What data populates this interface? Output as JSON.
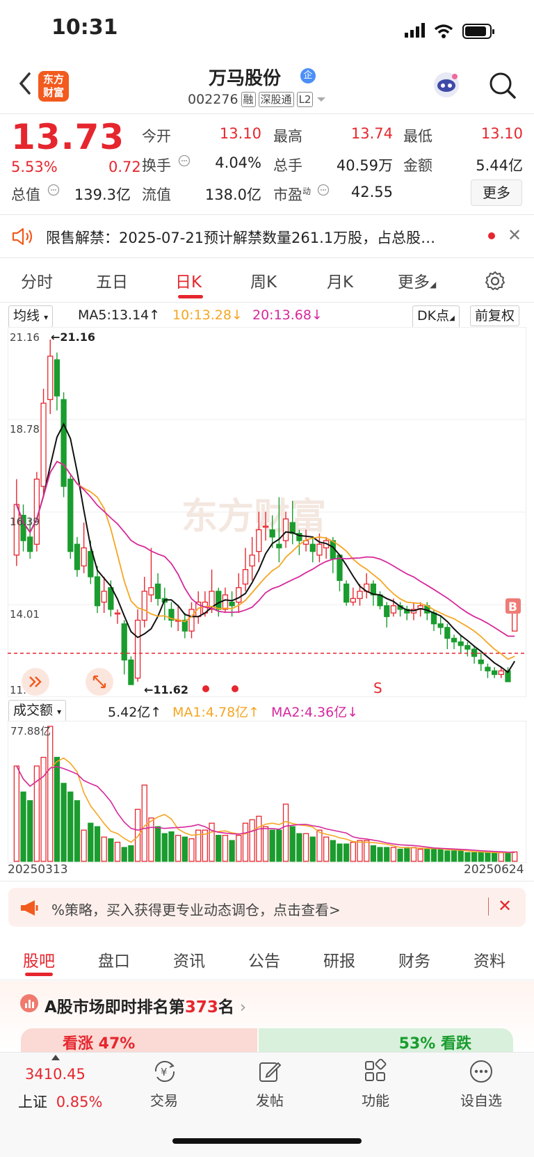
{
  "status_bar": {
    "time": "10:31"
  },
  "header": {
    "logo_text_line1": "东方",
    "logo_text_line2": "财富",
    "stock_name": "万马股份",
    "corp_badge": "企",
    "stock_code": "002276",
    "tags": [
      "融",
      "深股通",
      "L2"
    ]
  },
  "quote": {
    "price": "13.73",
    "change_pct": "5.53%",
    "change": "0.72",
    "open_label": "今开",
    "open": "13.10",
    "high_label": "最高",
    "high": "13.74",
    "low_label": "最低",
    "low": "13.10",
    "turnover_label": "换手",
    "turnover": "4.04%",
    "volume_label": "总手",
    "volume": "40.59万",
    "amount_label": "金额",
    "amount": "5.44亿",
    "mktcap_label": "总值",
    "mktcap": "139.3亿",
    "float_label": "流值",
    "float_cap": "138.0亿",
    "pe_label": "市盈",
    "pe_sup": "动",
    "pe": "42.55",
    "more_label": "更多"
  },
  "notice": {
    "text": "限售解禁：2025-07-21预计解禁数量261.1万股，占总股…"
  },
  "chart_tabs": [
    "分时",
    "五日",
    "日K",
    "周K",
    "月K",
    "更多"
  ],
  "ma_row": {
    "selector": "均线",
    "ma5": "MA5:13.14",
    "ma10": "10:13.28",
    "ma20": "20:13.68",
    "dk_label": "DK点",
    "adjust_label": "前复权"
  },
  "colors": {
    "up": "#e6262e",
    "down": "#1a9c2e",
    "ma5": "#111111",
    "ma10": "#f5a623",
    "ma20": "#d6289c"
  },
  "kline_axis": {
    "max": "21.16",
    "l2": "18.78",
    "l3": "16.39",
    "l4": "14.01",
    "min": "11.62",
    "max_mark": "21.16",
    "min_mark": "11.62"
  },
  "markers": {
    "b": "B",
    "s": "S"
  },
  "vol_row": {
    "selector": "成交额",
    "current": "5.42亿",
    "ma1": "MA1:4.78亿",
    "ma2": "MA2:4.36亿",
    "axis_max": "77.88亿"
  },
  "dates": {
    "start": "20250313",
    "end": "20250624"
  },
  "promo": {
    "text": "%策略，买入获得更专业动态调仓，点击查看>"
  },
  "bottom_tabs": [
    "股吧",
    "盘口",
    "资讯",
    "公告",
    "研报",
    "财务",
    "资料"
  ],
  "rank": {
    "prefix": "A股市场即时排名第",
    "number": "373",
    "suffix": "名"
  },
  "sentiment": {
    "left": "看涨 47%",
    "right": "53% 看跌"
  },
  "index": {
    "value": "3410.45",
    "name": "上证",
    "pct": "0.85%"
  },
  "bottom_nav": [
    "交易",
    "发帖",
    "功能",
    "设自选"
  ],
  "chart_data": {
    "type": "candlestick",
    "x_start": "20250313",
    "x_end": "20250624",
    "ylim": [
      11.62,
      21.16
    ],
    "candles": [
      [
        15.2,
        16.6,
        17.3,
        14.9
      ],
      [
        16.3,
        15.6,
        16.6,
        15.3
      ],
      [
        15.7,
        15.3,
        16.2,
        15.1
      ],
      [
        15.5,
        17.3,
        17.5,
        15.3
      ],
      [
        17.1,
        19.4,
        19.8,
        16.8
      ],
      [
        19.5,
        20.7,
        21.16,
        19.1
      ],
      [
        20.6,
        19.6,
        20.8,
        19.2
      ],
      [
        19.5,
        17.1,
        19.7,
        16.8
      ],
      [
        17.3,
        15.3,
        17.4,
        15.1
      ],
      [
        15.5,
        14.8,
        15.7,
        14.6
      ],
      [
        14.9,
        15.4,
        16.1,
        14.7
      ],
      [
        15.3,
        14.6,
        15.6,
        14.4
      ],
      [
        14.6,
        13.8,
        14.9,
        13.6
      ],
      [
        13.9,
        14.2,
        14.6,
        13.6
      ],
      [
        14.3,
        13.7,
        14.5,
        13.5
      ],
      [
        13.6,
        13.6,
        13.7,
        13.3
      ],
      [
        13.3,
        12.3,
        13.4,
        11.9
      ],
      [
        12.3,
        11.62,
        12.4,
        11.62
      ],
      [
        11.8,
        13.4,
        13.7,
        11.7
      ],
      [
        13.4,
        14.2,
        14.6,
        13.2
      ],
      [
        14.1,
        14.3,
        15.4,
        13.9
      ],
      [
        14.4,
        14.0,
        14.7,
        13.8
      ],
      [
        14.0,
        13.9,
        14.3,
        13.4
      ],
      [
        13.7,
        13.4,
        13.9,
        13.2
      ],
      [
        13.4,
        13.4,
        13.8,
        13.1
      ],
      [
        13.4,
        13.1,
        13.6,
        12.9
      ],
      [
        13.1,
        13.7,
        13.9,
        12.9
      ],
      [
        13.5,
        13.9,
        14.2,
        13.3
      ],
      [
        13.6,
        13.9,
        14.2,
        13.5
      ],
      [
        13.7,
        14.2,
        14.8,
        13.6
      ],
      [
        14.2,
        13.7,
        14.3,
        13.5
      ],
      [
        13.7,
        14.1,
        14.3,
        13.6
      ],
      [
        13.9,
        13.8,
        14.2,
        13.5
      ],
      [
        13.9,
        14.3,
        14.7,
        13.6
      ],
      [
        14.4,
        14.8,
        15.4,
        14.2
      ],
      [
        14.9,
        15.2,
        15.7,
        14.5
      ],
      [
        15.3,
        15.9,
        16.4,
        15.0
      ],
      [
        16.0,
        16.0,
        16.4,
        15.6
      ],
      [
        15.9,
        15.7,
        16.3,
        15.4
      ],
      [
        15.5,
        15.4,
        16.8,
        15.0
      ],
      [
        15.6,
        16.2,
        16.4,
        15.4
      ],
      [
        16.1,
        15.8,
        16.7,
        15.5
      ],
      [
        15.8,
        15.6,
        15.9,
        15.2
      ],
      [
        15.5,
        15.6,
        15.9,
        15.3
      ],
      [
        15.5,
        15.3,
        15.7,
        15.0
      ],
      [
        15.2,
        15.5,
        15.8,
        15.0
      ],
      [
        15.4,
        15.6,
        15.7,
        15.1
      ],
      [
        15.6,
        15.1,
        15.7,
        14.7
      ],
      [
        15.2,
        14.5,
        15.2,
        14.2
      ],
      [
        14.4,
        13.9,
        14.5,
        13.8
      ],
      [
        13.9,
        14.0,
        14.3,
        13.8
      ],
      [
        14.0,
        14.2,
        14.4,
        13.8
      ],
      [
        14.2,
        14.4,
        14.7,
        14.0
      ],
      [
        14.4,
        14.1,
        14.5,
        13.8
      ],
      [
        14.1,
        13.8,
        14.2,
        13.7
      ],
      [
        13.8,
        13.5,
        13.9,
        13.2
      ],
      [
        13.6,
        13.8,
        14.0,
        13.5
      ],
      [
        13.8,
        13.7,
        13.9,
        13.5
      ],
      [
        13.7,
        13.6,
        13.8,
        13.4
      ],
      [
        13.6,
        13.7,
        13.9,
        13.4
      ],
      [
        13.7,
        13.8,
        13.9,
        13.5
      ],
      [
        13.8,
        13.6,
        13.9,
        13.4
      ],
      [
        13.6,
        13.3,
        13.7,
        13.1
      ],
      [
        13.3,
        13.2,
        13.5,
        13.0
      ],
      [
        13.2,
        12.9,
        13.3,
        12.6
      ],
      [
        12.9,
        12.8,
        13.0,
        12.6
      ],
      [
        12.8,
        12.7,
        13.0,
        12.5
      ],
      [
        12.7,
        12.6,
        12.8,
        12.4
      ],
      [
        12.6,
        12.4,
        12.7,
        12.2
      ],
      [
        12.3,
        12.2,
        12.5,
        12.0
      ],
      [
        12.1,
        12.0,
        12.2,
        11.8
      ],
      [
        12.0,
        11.9,
        12.1,
        11.8
      ],
      [
        11.9,
        12.0,
        12.1,
        11.8
      ],
      [
        12.0,
        11.7,
        12.1,
        11.7
      ],
      [
        13.1,
        13.73,
        13.74,
        13.1
      ]
    ],
    "volume_max": 77.88,
    "volumes": [
      55,
      40,
      35,
      55,
      60,
      77.88,
      60,
      45,
      40,
      35,
      18,
      22,
      20,
      14,
      13,
      11,
      8,
      9,
      30,
      44,
      25,
      20,
      16,
      17,
      15,
      14,
      13,
      18,
      18,
      22,
      15,
      15,
      12,
      15,
      22,
      24,
      26,
      20,
      18,
      18,
      33,
      20,
      16,
      16,
      14,
      18,
      14,
      12,
      10,
      10,
      11,
      12,
      12,
      9,
      8,
      8,
      8,
      7,
      8,
      8,
      7,
      7,
      7,
      7,
      6,
      6,
      6,
      5,
      5,
      5,
      5,
      5,
      5,
      5,
      5.42
    ]
  }
}
